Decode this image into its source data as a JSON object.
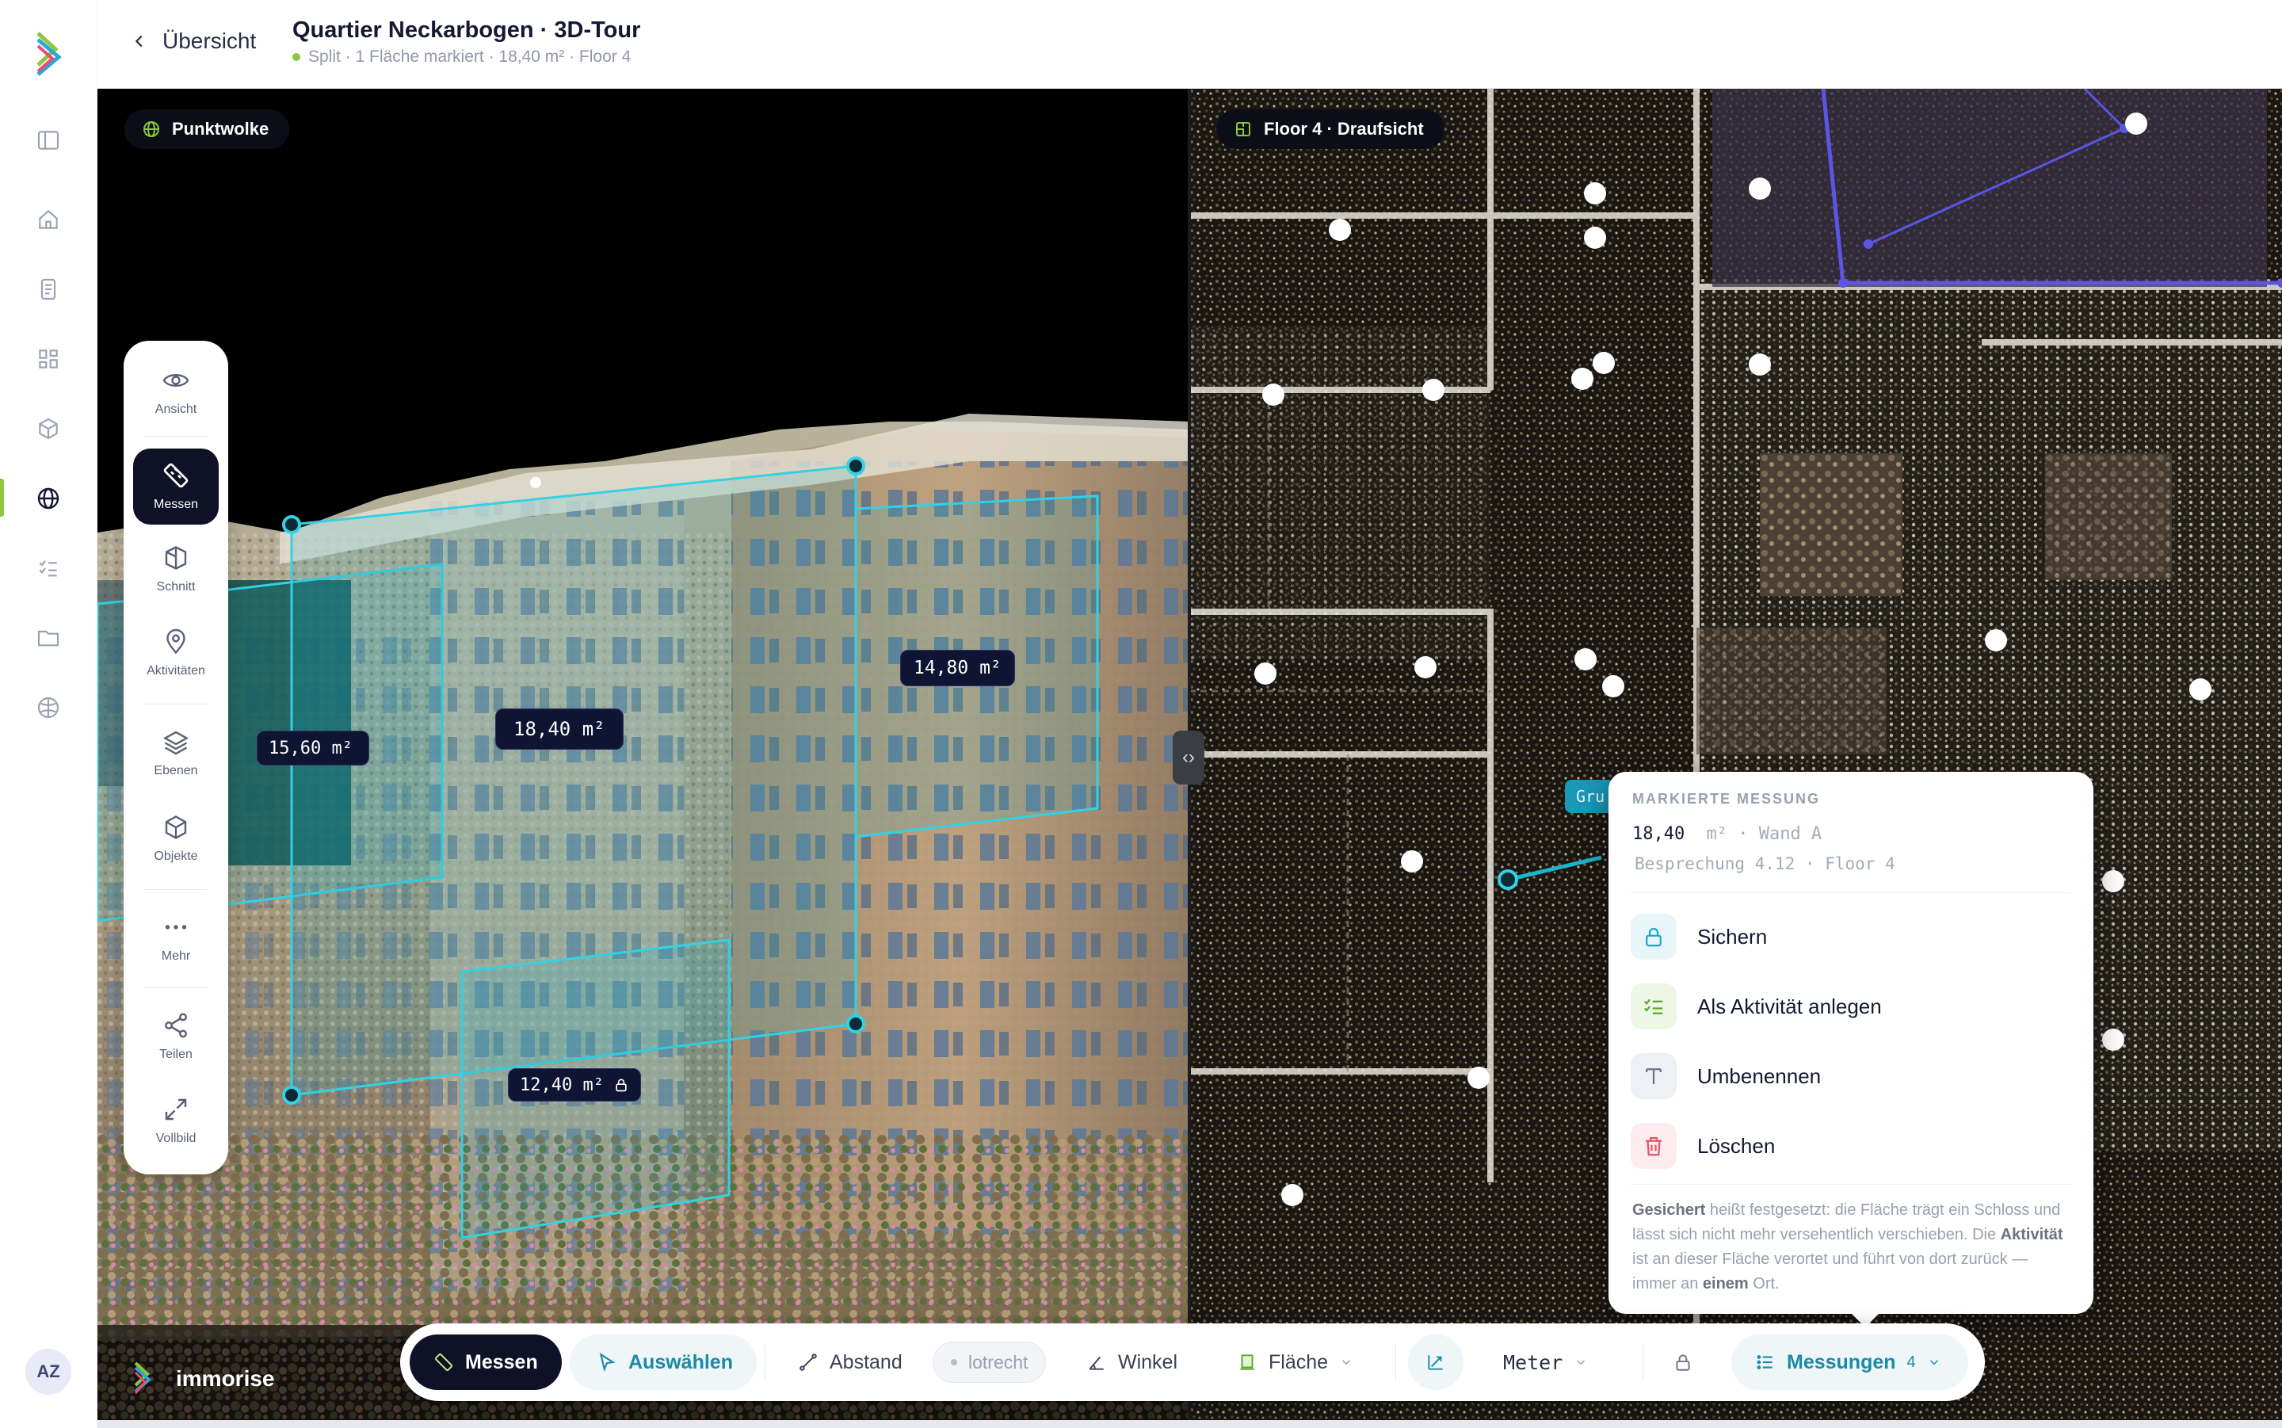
{
  "header": {
    "back_label": "Übersicht",
    "title": "Quartier Neckarbogen · 3D-Tour",
    "subtitle": "Split · 1 Fläche markiert · 18,40 m² · Floor 4"
  },
  "rail": {
    "avatar_initials": "AZ",
    "items": [
      "sidebar-toggle-icon",
      "home-icon",
      "document-icon",
      "dashboard-icon",
      "cube-icon",
      "globe-icon",
      "checklist-icon",
      "folder-icon",
      "settings-icon"
    ],
    "active": "globe-icon"
  },
  "viewports": {
    "left_label": "Punktwolke",
    "right_label": "Floor 4 · Draufsicht",
    "divider_glyph": "‹›"
  },
  "palette": {
    "tools": [
      {
        "label": "Ansicht",
        "icon": "eye-icon"
      },
      {
        "label": "Messen",
        "icon": "ruler-icon",
        "active": true
      },
      {
        "label": "Schnitt",
        "icon": "section-icon"
      },
      {
        "label": "Aktivitäten",
        "icon": "pin-icon"
      },
      {
        "label": "Ebenen",
        "icon": "layers-icon"
      },
      {
        "label": "Objekte",
        "icon": "box-icon"
      },
      {
        "label": "Mehr",
        "icon": "more-icon"
      },
      {
        "label": "Teilen",
        "icon": "share-icon"
      },
      {
        "label": "Vollbild",
        "icon": "expand-icon"
      }
    ]
  },
  "measurements": {
    "m1": "15,60 m²",
    "m2": "18,40 m²",
    "m3": "14,80 m²",
    "m4": "12,40 m²",
    "right_tag": "Gru"
  },
  "popover": {
    "heading": "MARKIERTE MESSUNG",
    "value": "18,40",
    "unit_and_wall": "m² · Wand A",
    "location": "Besprechung 4.12 · Floor 4",
    "actions": [
      {
        "label": "Sichern",
        "icon": "lock-icon",
        "color": "#e9f6f9"
      },
      {
        "label": "Als Aktivität anlegen",
        "icon": "checklist-icon",
        "color": "#eef7e6"
      },
      {
        "label": "Umbenennen",
        "icon": "text-icon",
        "color": "#eff0f5"
      },
      {
        "label": "Löschen",
        "icon": "trash-icon",
        "color": "#fdecef"
      }
    ],
    "note": {
      "b1": "Gesichert",
      "t1": " heißt festgesetzt: die Fläche trägt ein Schloss und lässt sich nicht mehr versehentlich verschieben. Die ",
      "b2": "Aktivität",
      "t2": " ist an dieser Fläche verortet und führt von dort zurück — immer an ",
      "b3": "einem",
      "t3": " Ort."
    }
  },
  "toolbar": {
    "measure": "Messen",
    "select": "Auswählen",
    "distance": "Abstand",
    "vertical": "lotrecht",
    "angle": "Winkel",
    "area": "Fläche",
    "unit": "Meter",
    "measurements": "Messungen",
    "measurements_count": "4"
  },
  "brand": {
    "name": "immorise"
  },
  "colors": {
    "accent_teal": "#19b6cc",
    "brand_green": "#8dc63f",
    "dark": "#0f1226",
    "delete_red": "#e0566b"
  }
}
